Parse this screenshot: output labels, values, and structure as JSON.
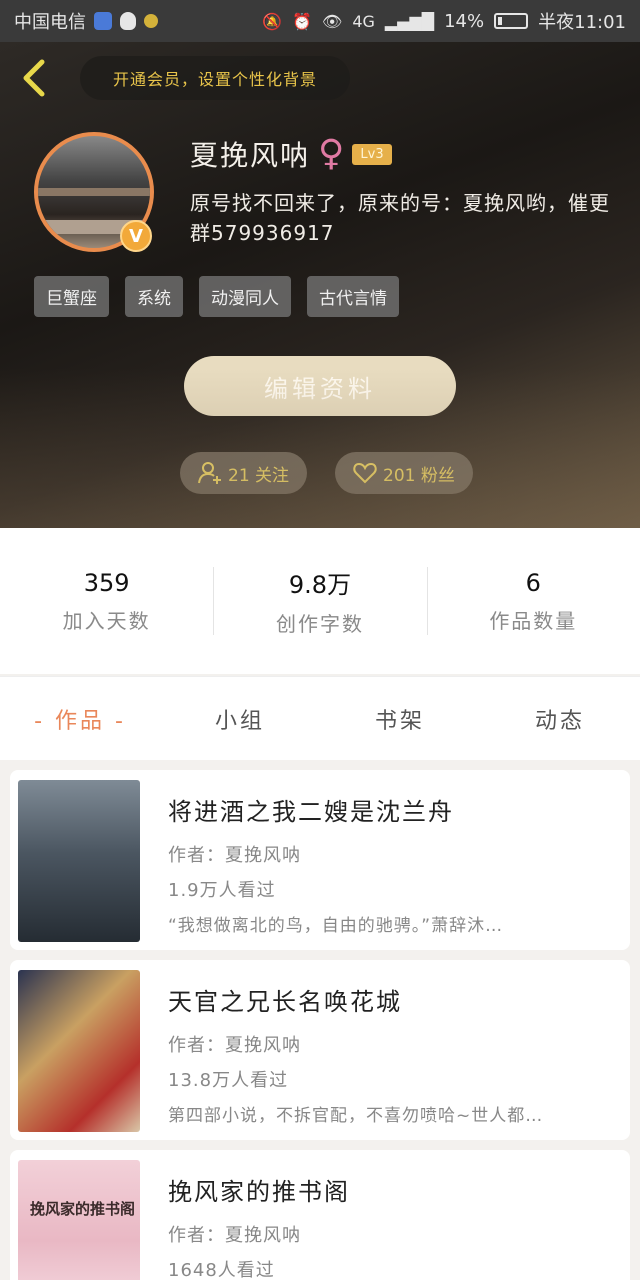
{
  "status_bar": {
    "carrier": "中国电信",
    "network": "4G",
    "battery": "14%",
    "battery_level": 0.14,
    "time": "半夜11:01"
  },
  "header": {
    "vip_banner": "开通会员，设置个性化背景",
    "username": "夏挽风呐",
    "gender_symbol": "♀",
    "level": "Lv3",
    "verified_badge": "V",
    "bio": "原号找不回来了，原来的号：夏挽风哟，催更群579936917",
    "tags": [
      "巨蟹座",
      "系统",
      "动漫同人",
      "古代言情"
    ],
    "edit_button": "编辑资料",
    "following": "21 关注",
    "fans": "201 粉丝"
  },
  "stats": [
    {
      "value": "359",
      "label": "加入天数"
    },
    {
      "value": "9.8万",
      "label": "创作字数"
    },
    {
      "value": "6",
      "label": "作品数量"
    }
  ],
  "tabs": [
    {
      "label": "- 作品 -",
      "active": true
    },
    {
      "label": "小组",
      "active": false
    },
    {
      "label": "书架",
      "active": false
    },
    {
      "label": "动态",
      "active": false
    }
  ],
  "books": [
    {
      "title": "将进酒之我二嫂是沈兰舟",
      "author": "作者：夏挽风呐",
      "views": "1.9万人看过",
      "desc": "“我想做离北的鸟，自由的驰骋。”萧辞沐…"
    },
    {
      "title": "天官之兄长名唤花城",
      "author": "作者：夏挽风呐",
      "views": "13.8万人看过",
      "desc": "第四部小说，不拆官配，不喜勿喷哈~世人都…"
    },
    {
      "title": "挽风家的推书阁",
      "author": "作者：夏挽风呐",
      "views": "1648人看过",
      "cover_text": "挽风家的推书阁",
      "desc": ""
    }
  ],
  "colors": {
    "accent": "#e9875a",
    "gold": "#e8c44a",
    "avatar_ring": "#e98c4d"
  }
}
